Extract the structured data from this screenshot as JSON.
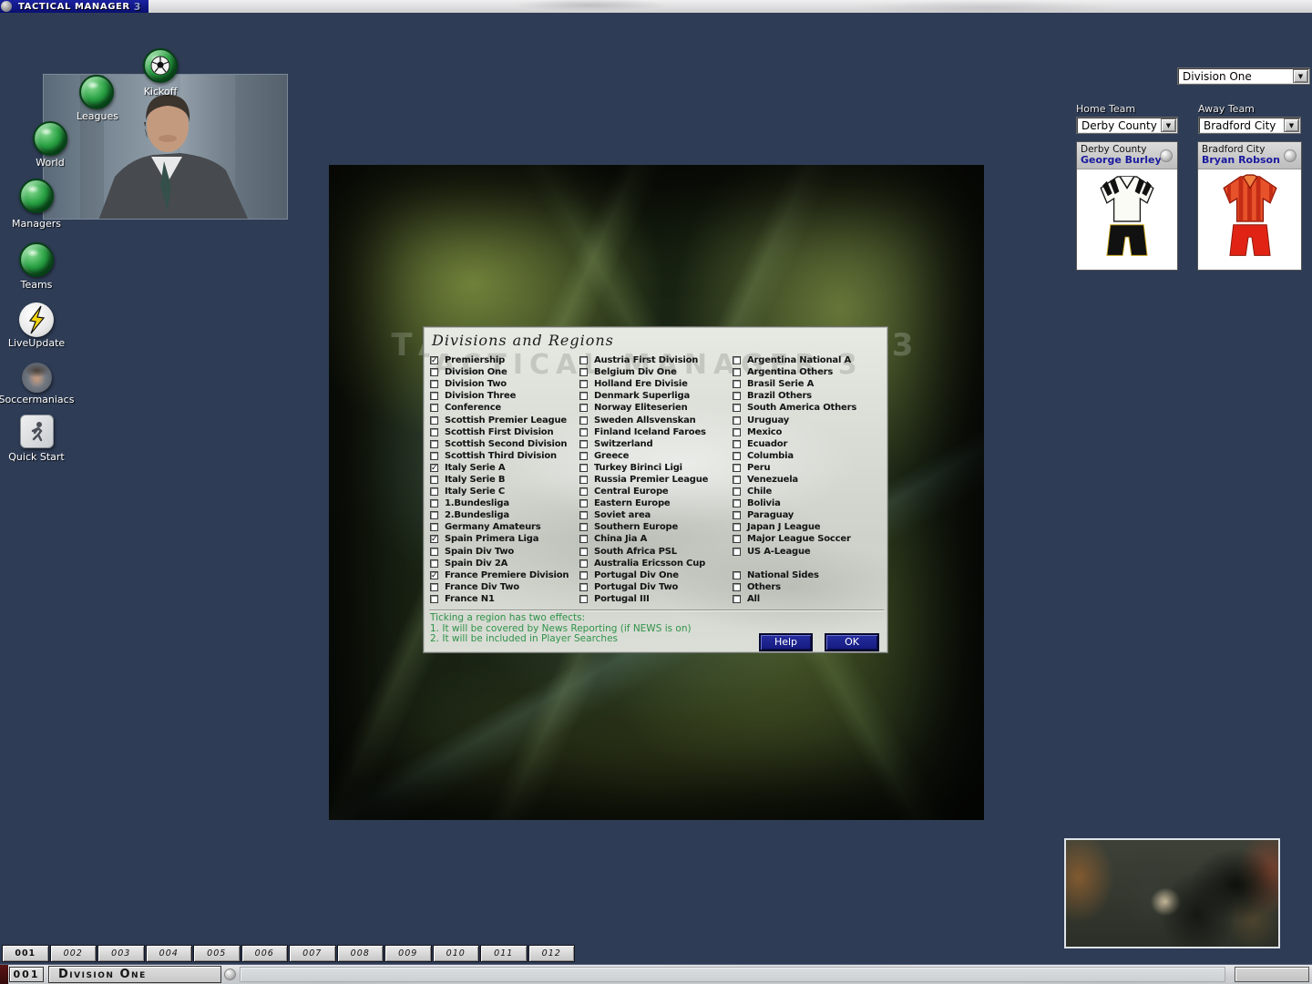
{
  "app": {
    "title": "TACTICAL MANAGER",
    "version": "3"
  },
  "sidebar": {
    "nav_buttons": [
      {
        "id": "kickoff",
        "label": "Kickoff"
      },
      {
        "id": "leagues",
        "label": "Leagues"
      },
      {
        "id": "world",
        "label": "World"
      },
      {
        "id": "managers",
        "label": "Managers"
      },
      {
        "id": "teams",
        "label": "Teams"
      }
    ],
    "tools": [
      {
        "id": "liveupdate",
        "label": "LiveUpdate"
      },
      {
        "id": "soccermaniacs",
        "label": "Soccermaniacs"
      },
      {
        "id": "quickstart",
        "label": "Quick Start"
      }
    ]
  },
  "match_setup": {
    "division_selected": "Division One",
    "home_label": "Home Team",
    "away_label": "Away Team",
    "home_team": "Derby County",
    "home_manager": "George Burley",
    "away_team": "Bradford City",
    "away_manager": "Bryan Robson"
  },
  "dialog": {
    "title": "Divisions and Regions",
    "columns": [
      {
        "items": [
          {
            "label": "Premiership",
            "checked": true
          },
          {
            "label": "Division One",
            "checked": false
          },
          {
            "label": "Division Two",
            "checked": false
          },
          {
            "label": "Division Three",
            "checked": false
          },
          {
            "label": "Conference",
            "checked": false
          },
          {
            "label": "Scottish Premier League",
            "checked": false
          },
          {
            "label": "Scottish First Division",
            "checked": false
          },
          {
            "label": "Scottish Second Division",
            "checked": false
          },
          {
            "label": "Scottish Third Division",
            "checked": false
          },
          {
            "label": "Italy Serie A",
            "checked": true
          },
          {
            "label": "Italy Serie B",
            "checked": false
          },
          {
            "label": "Italy Serie C",
            "checked": false
          },
          {
            "label": "1.Bundesliga",
            "checked": false
          },
          {
            "label": "2.Bundesliga",
            "checked": false
          },
          {
            "label": "Germany Amateurs",
            "checked": false
          },
          {
            "label": "Spain Primera Liga",
            "checked": true
          },
          {
            "label": "Spain Div Two",
            "checked": false
          },
          {
            "label": "Spain Div 2A",
            "checked": false
          },
          {
            "label": "France Premiere Division",
            "checked": true
          },
          {
            "label": "France Div Two",
            "checked": false
          },
          {
            "label": "France N1",
            "checked": false
          }
        ]
      },
      {
        "items": [
          {
            "label": "Austria First Division",
            "checked": false
          },
          {
            "label": "Belgium Div One",
            "checked": false
          },
          {
            "label": "Holland Ere Divisie",
            "checked": false
          },
          {
            "label": "Denmark Superliga",
            "checked": false
          },
          {
            "label": "Norway Eliteserien",
            "checked": false
          },
          {
            "label": "Sweden Allsvenskan",
            "checked": false
          },
          {
            "label": "Finland Iceland Faroes",
            "checked": false
          },
          {
            "label": "Switzerland",
            "checked": false
          },
          {
            "label": "Greece",
            "checked": false
          },
          {
            "label": "Turkey Birinci Ligi",
            "checked": false
          },
          {
            "label": "Russia Premier League",
            "checked": false
          },
          {
            "label": "Central Europe",
            "checked": false
          },
          {
            "label": "Eastern Europe",
            "checked": false
          },
          {
            "label": "Soviet area",
            "checked": false
          },
          {
            "label": "Southern Europe",
            "checked": false
          },
          {
            "label": "China Jia A",
            "checked": false
          },
          {
            "label": "South Africa PSL",
            "checked": false
          },
          {
            "label": "Australia Ericsson Cup",
            "checked": false
          },
          {
            "label": "Portugal Div One",
            "checked": false
          },
          {
            "label": "Portugal Div Two",
            "checked": false
          },
          {
            "label": "Portugal III",
            "checked": false
          }
        ]
      },
      {
        "items": [
          {
            "label": "Argentina National A",
            "checked": false
          },
          {
            "label": "Argentina Others",
            "checked": false
          },
          {
            "label": "Brasil Serie A",
            "checked": false
          },
          {
            "label": "Brazil Others",
            "checked": false
          },
          {
            "label": "South America Others",
            "checked": false
          },
          {
            "label": "Uruguay",
            "checked": false
          },
          {
            "label": "Mexico",
            "checked": false
          },
          {
            "label": "Ecuador",
            "checked": false
          },
          {
            "label": "Columbia",
            "checked": false
          },
          {
            "label": "Peru",
            "checked": false
          },
          {
            "label": "Venezuela",
            "checked": false
          },
          {
            "label": "Chile",
            "checked": false
          },
          {
            "label": "Bolivia",
            "checked": false
          },
          {
            "label": "Paraguay",
            "checked": false
          },
          {
            "label": "Japan J League",
            "checked": false
          },
          {
            "label": "Major League Soccer",
            "checked": false
          },
          {
            "label": "US A-League",
            "checked": false
          },
          {
            "spacer": true
          },
          {
            "label": "National Sides",
            "checked": false
          },
          {
            "label": "Others",
            "checked": false
          },
          {
            "label": "All",
            "checked": false
          }
        ]
      }
    ],
    "notes": [
      "Ticking a region has two effects:",
      "1. It will be covered by News Reporting (if NEWS is on)",
      "2. It will be included in Player Searches"
    ],
    "buttons": {
      "help": "Help",
      "ok": "OK"
    }
  },
  "footer": {
    "tabs": [
      "001",
      "002",
      "003",
      "004",
      "005",
      "006",
      "007",
      "008",
      "009",
      "010",
      "011",
      "012"
    ],
    "active_tab": "001",
    "status_page": "001",
    "status_label": "Division One"
  },
  "colors": {
    "background_navy": "#2e3c55",
    "titlebar_blue": "#0a0f70",
    "button_green": "#1d9e3e",
    "note_green": "#2f9348",
    "action_button_navy": "#141a7e",
    "manager_name_blue": "#1a1a9e"
  },
  "watermark": "TACTICAL MANAGER 3"
}
